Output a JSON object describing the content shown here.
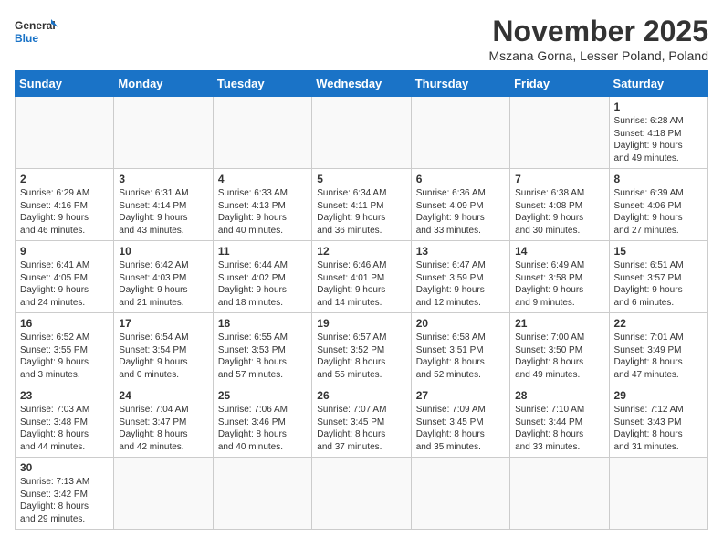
{
  "header": {
    "logo_general": "General",
    "logo_blue": "Blue",
    "month_title": "November 2025",
    "location": "Mszana Gorna, Lesser Poland, Poland"
  },
  "days_of_week": [
    "Sunday",
    "Monday",
    "Tuesday",
    "Wednesday",
    "Thursday",
    "Friday",
    "Saturday"
  ],
  "weeks": [
    [
      null,
      null,
      null,
      null,
      null,
      null,
      {
        "day": 1,
        "sunrise": "6:28 AM",
        "sunset": "4:18 PM",
        "daylight_hours": 9,
        "daylight_minutes": 49
      }
    ],
    [
      {
        "day": 2,
        "sunrise": "6:29 AM",
        "sunset": "4:16 PM",
        "daylight_hours": 9,
        "daylight_minutes": 46
      },
      {
        "day": 3,
        "sunrise": "6:31 AM",
        "sunset": "4:14 PM",
        "daylight_hours": 9,
        "daylight_minutes": 43
      },
      {
        "day": 4,
        "sunrise": "6:33 AM",
        "sunset": "4:13 PM",
        "daylight_hours": 9,
        "daylight_minutes": 40
      },
      {
        "day": 5,
        "sunrise": "6:34 AM",
        "sunset": "4:11 PM",
        "daylight_hours": 9,
        "daylight_minutes": 36
      },
      {
        "day": 6,
        "sunrise": "6:36 AM",
        "sunset": "4:09 PM",
        "daylight_hours": 9,
        "daylight_minutes": 33
      },
      {
        "day": 7,
        "sunrise": "6:38 AM",
        "sunset": "4:08 PM",
        "daylight_hours": 9,
        "daylight_minutes": 30
      },
      {
        "day": 8,
        "sunrise": "6:39 AM",
        "sunset": "4:06 PM",
        "daylight_hours": 9,
        "daylight_minutes": 27
      }
    ],
    [
      {
        "day": 9,
        "sunrise": "6:41 AM",
        "sunset": "4:05 PM",
        "daylight_hours": 9,
        "daylight_minutes": 24
      },
      {
        "day": 10,
        "sunrise": "6:42 AM",
        "sunset": "4:03 PM",
        "daylight_hours": 9,
        "daylight_minutes": 21
      },
      {
        "day": 11,
        "sunrise": "6:44 AM",
        "sunset": "4:02 PM",
        "daylight_hours": 9,
        "daylight_minutes": 18
      },
      {
        "day": 12,
        "sunrise": "6:46 AM",
        "sunset": "4:01 PM",
        "daylight_hours": 9,
        "daylight_minutes": 14
      },
      {
        "day": 13,
        "sunrise": "6:47 AM",
        "sunset": "3:59 PM",
        "daylight_hours": 9,
        "daylight_minutes": 12
      },
      {
        "day": 14,
        "sunrise": "6:49 AM",
        "sunset": "3:58 PM",
        "daylight_hours": 9,
        "daylight_minutes": 9
      },
      {
        "day": 15,
        "sunrise": "6:51 AM",
        "sunset": "3:57 PM",
        "daylight_hours": 9,
        "daylight_minutes": 6
      }
    ],
    [
      {
        "day": 16,
        "sunrise": "6:52 AM",
        "sunset": "3:55 PM",
        "daylight_hours": 9,
        "daylight_minutes": 3
      },
      {
        "day": 17,
        "sunrise": "6:54 AM",
        "sunset": "3:54 PM",
        "daylight_hours": 9,
        "daylight_minutes": 0
      },
      {
        "day": 18,
        "sunrise": "6:55 AM",
        "sunset": "3:53 PM",
        "daylight_hours": 8,
        "daylight_minutes": 57
      },
      {
        "day": 19,
        "sunrise": "6:57 AM",
        "sunset": "3:52 PM",
        "daylight_hours": 8,
        "daylight_minutes": 55
      },
      {
        "day": 20,
        "sunrise": "6:58 AM",
        "sunset": "3:51 PM",
        "daylight_hours": 8,
        "daylight_minutes": 52
      },
      {
        "day": 21,
        "sunrise": "7:00 AM",
        "sunset": "3:50 PM",
        "daylight_hours": 8,
        "daylight_minutes": 49
      },
      {
        "day": 22,
        "sunrise": "7:01 AM",
        "sunset": "3:49 PM",
        "daylight_hours": 8,
        "daylight_minutes": 47
      }
    ],
    [
      {
        "day": 23,
        "sunrise": "7:03 AM",
        "sunset": "3:48 PM",
        "daylight_hours": 8,
        "daylight_minutes": 44
      },
      {
        "day": 24,
        "sunrise": "7:04 AM",
        "sunset": "3:47 PM",
        "daylight_hours": 8,
        "daylight_minutes": 42
      },
      {
        "day": 25,
        "sunrise": "7:06 AM",
        "sunset": "3:46 PM",
        "daylight_hours": 8,
        "daylight_minutes": 40
      },
      {
        "day": 26,
        "sunrise": "7:07 AM",
        "sunset": "3:45 PM",
        "daylight_hours": 8,
        "daylight_minutes": 37
      },
      {
        "day": 27,
        "sunrise": "7:09 AM",
        "sunset": "3:45 PM",
        "daylight_hours": 8,
        "daylight_minutes": 35
      },
      {
        "day": 28,
        "sunrise": "7:10 AM",
        "sunset": "3:44 PM",
        "daylight_hours": 8,
        "daylight_minutes": 33
      },
      {
        "day": 29,
        "sunrise": "7:12 AM",
        "sunset": "3:43 PM",
        "daylight_hours": 8,
        "daylight_minutes": 31
      }
    ],
    [
      {
        "day": 30,
        "sunrise": "7:13 AM",
        "sunset": "3:42 PM",
        "daylight_hours": 8,
        "daylight_minutes": 29
      },
      null,
      null,
      null,
      null,
      null,
      null
    ]
  ]
}
